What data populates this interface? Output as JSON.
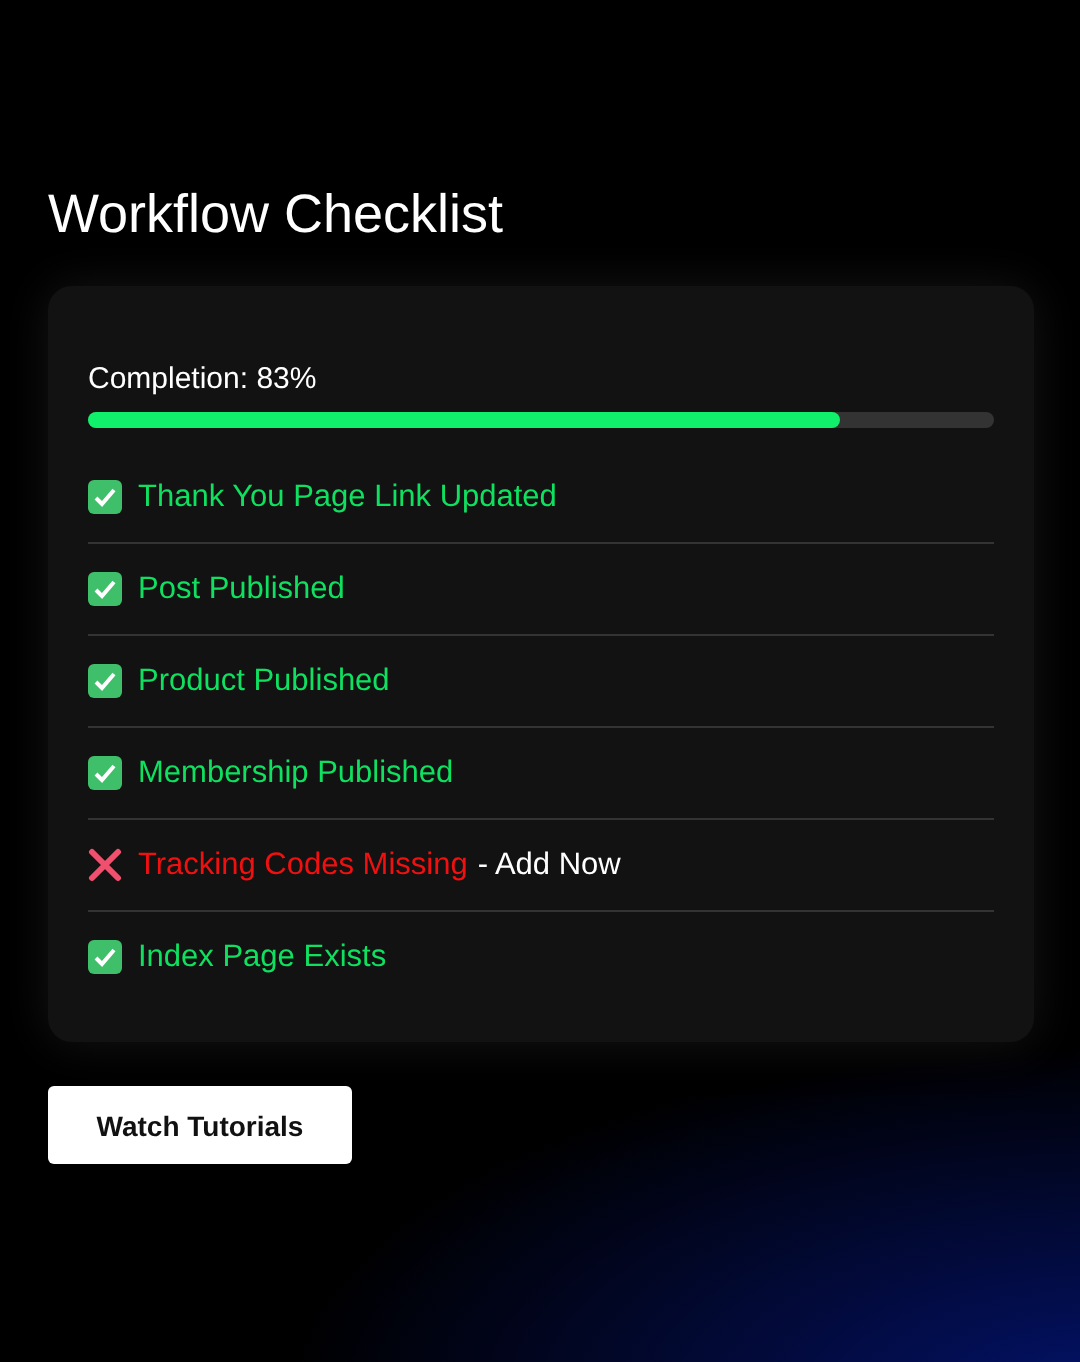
{
  "title": "Workflow Checklist",
  "completion": {
    "label": "Completion: 83%",
    "level": 0.83
  },
  "items": [
    {
      "label": "Thank You Page Link Updated",
      "checked": true
    },
    {
      "label": "Post Published",
      "checked": true
    },
    {
      "label": "Product Published",
      "checked": true
    },
    {
      "label": "Membership Published",
      "checked": true
    },
    {
      "label": "Tracking Codes Missing",
      "checked": false,
      "action": "- Add Now"
    },
    {
      "label": "Index Page Exists",
      "checked": true
    }
  ],
  "button": "Watch Tutorials"
}
